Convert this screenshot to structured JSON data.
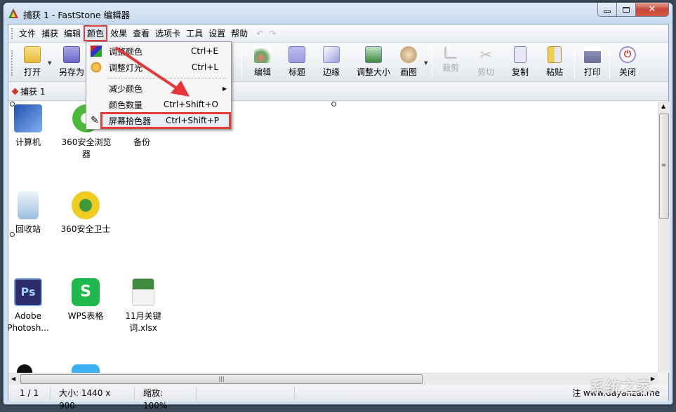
{
  "window": {
    "title": "捕获 1 - FastStone 编辑器",
    "caption_buttons": [
      "minimize",
      "maximize",
      "close"
    ]
  },
  "menubar": {
    "items": [
      "文件",
      "捕获",
      "编辑",
      "颜色",
      "效果",
      "查看",
      "选项卡",
      "工具",
      "设置",
      "帮助"
    ],
    "active_index": 3
  },
  "toolbar": {
    "buttons": [
      {
        "label": "打开",
        "icon": "folder-open-icon",
        "enabled": true,
        "has_dropdown": true
      },
      {
        "label": "另存为",
        "icon": "floppy-disk-icon",
        "enabled": true
      },
      {
        "label": "编辑",
        "icon": "paint-letter-a-icon",
        "enabled": true
      },
      {
        "label": "标题",
        "icon": "caption-window-icon",
        "enabled": true
      },
      {
        "label": "边缘",
        "icon": "torn-edge-icon",
        "enabled": true
      },
      {
        "label": "调整大小",
        "icon": "resize-image-icon",
        "enabled": true
      },
      {
        "label": "画图",
        "icon": "paint-palette-icon",
        "enabled": true,
        "has_dropdown": true
      },
      {
        "label": "裁剪",
        "icon": "crop-icon",
        "enabled": false
      },
      {
        "label": "剪切",
        "icon": "scissors-icon",
        "enabled": false
      },
      {
        "label": "复制",
        "icon": "copy-icon",
        "enabled": true
      },
      {
        "label": "粘贴",
        "icon": "paste-icon",
        "enabled": true
      },
      {
        "label": "打印",
        "icon": "printer-icon",
        "enabled": true
      },
      {
        "label": "关闭",
        "icon": "power-icon",
        "enabled": true
      }
    ]
  },
  "tabs": [
    {
      "label": "捕获 1"
    }
  ],
  "color_menu": {
    "items": [
      {
        "label": "调整颜色",
        "shortcut": "Ctrl+E",
        "icon": "color-squares-icon"
      },
      {
        "label": "调整灯光",
        "shortcut": "Ctrl+L",
        "icon": "sun-icon"
      },
      {
        "label": "减少颜色",
        "shortcut": "",
        "submenu": true
      },
      {
        "label": "颜色数量",
        "shortcut": "Ctrl+Shift+O"
      },
      {
        "label": "屏幕拾色器",
        "shortcut": "Ctrl+Shift+P",
        "icon": "eyedropper-icon",
        "highlighted": true
      }
    ]
  },
  "canvas": {
    "desktop_icons": [
      {
        "label": "计算机",
        "icon": "computer-icon",
        "color": "#2a6fc9"
      },
      {
        "label": "360安全浏览器",
        "icon": "browser-360-icon",
        "color": "#4cb93c"
      },
      {
        "label": "备份",
        "icon": "folder-icon",
        "color": "#e0c060"
      },
      {
        "label": "回收站",
        "icon": "recycle-bin-icon",
        "color": "#7aa7d4"
      },
      {
        "label": "360安全卫士",
        "icon": "guard-360-icon",
        "color": "#e6c01c"
      },
      {
        "label": "Adobe Photosh...",
        "icon": "photoshop-icon",
        "color": "#2c2a6b"
      },
      {
        "label": "WPS表格",
        "icon": "wps-sheet-icon",
        "color": "#1fb84c"
      },
      {
        "label": "11月关键词.xlsx",
        "icon": "excel-file-icon",
        "color": "#3f8a3f"
      }
    ]
  },
  "statusbar": {
    "page": "1 / 1",
    "size": "大小: 1440 x 900",
    "zoom": "缩放: 100%",
    "note": "注  www.dayanzai.me"
  },
  "watermark": "系统之家"
}
